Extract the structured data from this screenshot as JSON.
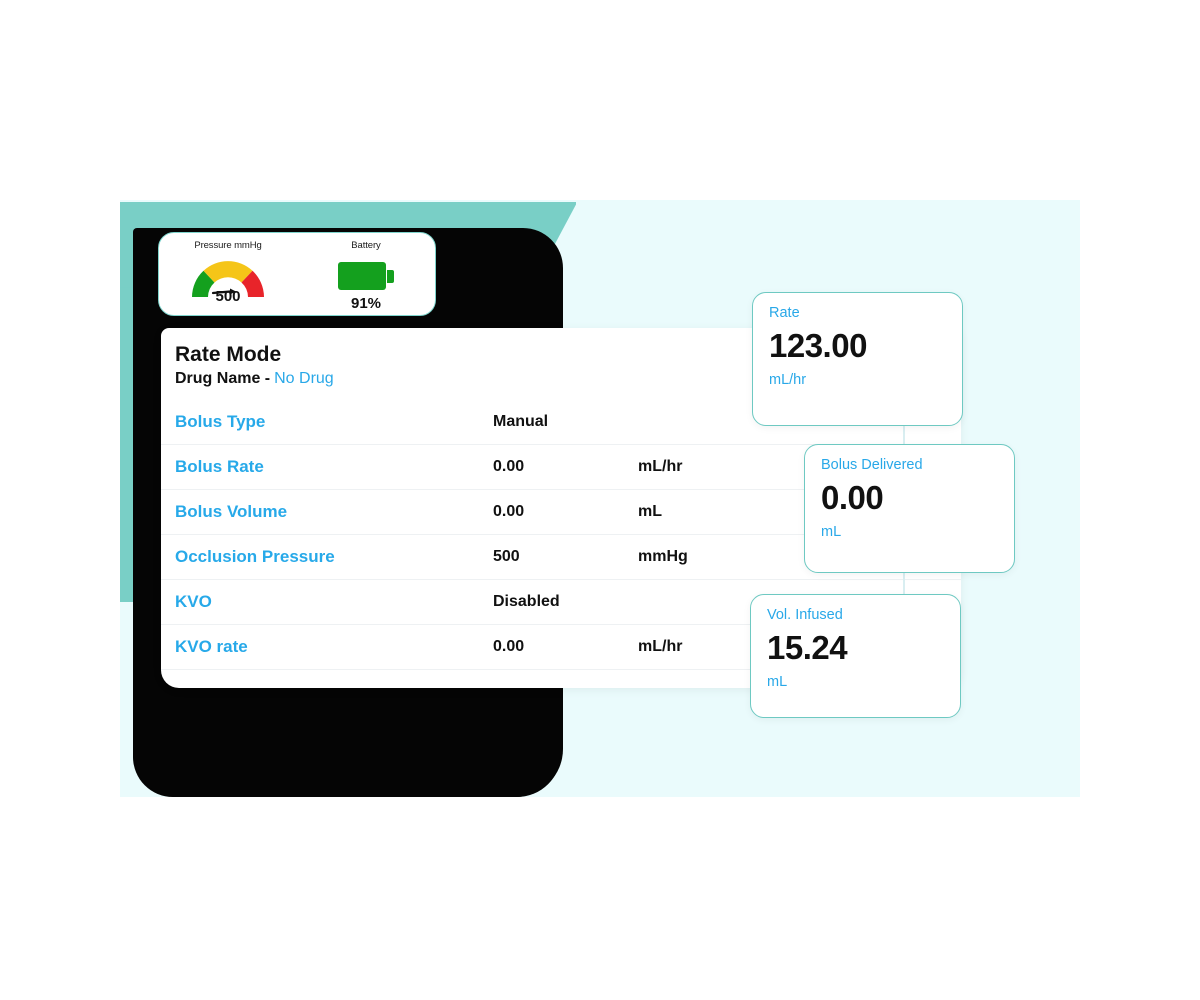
{
  "theme": {
    "accent_cyan": "#29a8e8",
    "teal": "#79cfc6",
    "card_border": "#6ec9c2",
    "backdrop": "#eafbfc",
    "battery_green": "#14a01e",
    "gauge_green": "#14a01e",
    "gauge_yellow": "#f5c518",
    "gauge_red": "#e8242a"
  },
  "status_bar": {
    "pressure": {
      "title": "Pressure mmHg",
      "value": "500",
      "icon": "gauge-icon"
    },
    "battery": {
      "title": "Battery",
      "value": "91%",
      "icon": "battery-icon"
    }
  },
  "main": {
    "mode_title": "Rate Mode",
    "drug_label": "Drug Name -",
    "drug_value": "No Drug",
    "rows": [
      {
        "label": "Bolus Type",
        "value": "Manual",
        "unit": ""
      },
      {
        "label": "Bolus Rate",
        "value": "0.00",
        "unit": "mL/hr"
      },
      {
        "label": "Bolus Volume",
        "value": "0.00",
        "unit": "mL"
      },
      {
        "label": "Occlusion Pressure",
        "value": "500",
        "unit": "mmHg"
      },
      {
        "label": "KVO",
        "value": "Disabled",
        "unit": ""
      },
      {
        "label": "KVO rate",
        "value": "0.00",
        "unit": "mL/hr"
      }
    ]
  },
  "metric_cards": [
    {
      "label": "Rate",
      "value": "123.00",
      "unit": "mL/hr"
    },
    {
      "label": "Bolus Delivered",
      "value": "0.00",
      "unit": "mL"
    },
    {
      "label": "Vol. Infused",
      "value": "15.24",
      "unit": "mL"
    }
  ]
}
